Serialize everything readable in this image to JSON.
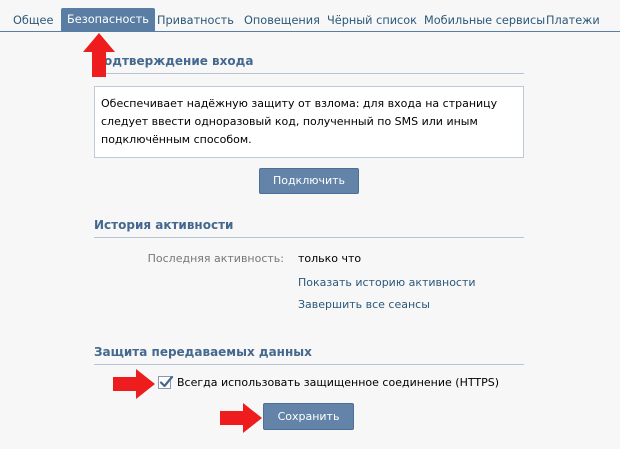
{
  "tabs": [
    {
      "label": "Общее",
      "active": false
    },
    {
      "label": "Безопасность",
      "active": true
    },
    {
      "label": "Приватность",
      "active": false
    },
    {
      "label": "Оповещения",
      "active": false
    },
    {
      "label": "Чёрный список",
      "active": false
    },
    {
      "label": "Мобильные сервисы",
      "active": false
    },
    {
      "label": "Платежи",
      "active": false
    }
  ],
  "login_confirm": {
    "title": "Подтверждение входа",
    "description": "Обеспечивает надёжную защиту от взлома: для входа на страницу следует ввести одноразовый код, полученный по SMS или иным подключённым способом.",
    "connect_button": "Подключить"
  },
  "activity": {
    "title": "История активности",
    "last_activity_label": "Последняя активность:",
    "last_activity_value": "только что",
    "show_history_link": "Показать историю активности",
    "end_sessions_link": "Завершить все сеансы"
  },
  "data_protection": {
    "title": "Защита передаваемых данных",
    "https_label": "Всегда использовать защищенное соединение (HTTPS)",
    "https_checked": true,
    "save_button": "Сохранить"
  },
  "colors": {
    "accent": "#597da3",
    "link": "#2b587a",
    "arrow": "#ee1c1c"
  },
  "icons": {
    "arrow": "red-arrow-icon",
    "check": "checkmark-icon"
  }
}
